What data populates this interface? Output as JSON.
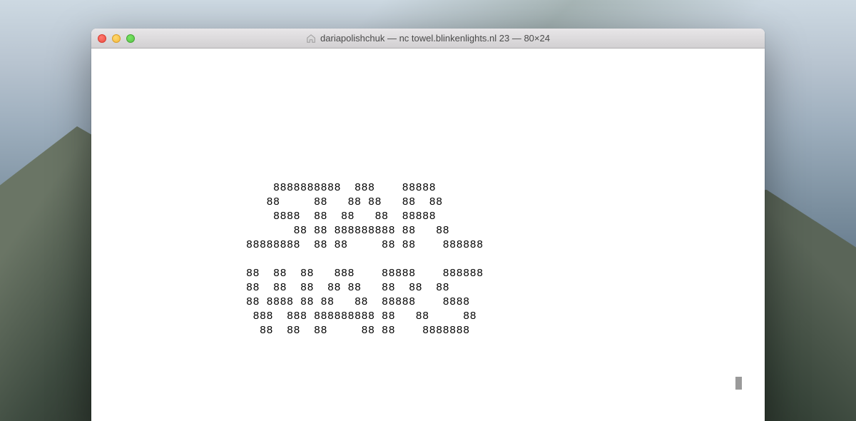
{
  "window": {
    "title": "dariapolishchuk — nc towel.blinkenlights.nl 23 — 80×24"
  },
  "terminal": {
    "lines": [
      "",
      "",
      "",
      "",
      "",
      "",
      "",
      "",
      "                          8888888888  888    88888",
      "                         88     88   88 88   88  88",
      "                          8888  88  88   88  88888",
      "                             88 88 888888888 88   88",
      "                      88888888  88 88     88 88    888888",
      "",
      "                      88  88  88   888    88888    888888",
      "                      88  88  88  88 88   88  88  88",
      "                      88 8888 88 88   88  88888    8888",
      "                       888  888 888888888 88   88     88",
      "                        88  88  88     88 88    8888888"
    ]
  }
}
